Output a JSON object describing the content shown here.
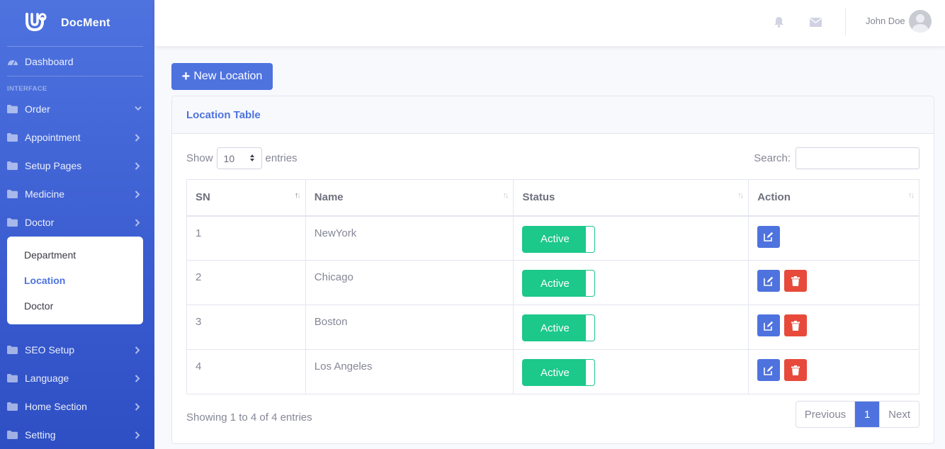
{
  "brand": {
    "name": "DocMent"
  },
  "sidebar": {
    "dashboard": "Dashboard",
    "heading": "INTERFACE",
    "items": [
      {
        "label": "Order",
        "icon": "folder-icon",
        "chevron": "down"
      },
      {
        "label": "Appointment",
        "icon": "folder-icon",
        "chevron": "right"
      },
      {
        "label": "Setup Pages",
        "icon": "folder-icon",
        "chevron": "right"
      },
      {
        "label": "Medicine",
        "icon": "folder-icon",
        "chevron": "right"
      },
      {
        "label": "Doctor",
        "icon": "folder-icon",
        "chevron": "right"
      }
    ],
    "submenu": [
      "Department",
      "Location",
      "Doctor"
    ],
    "submenu_active": "Location",
    "items_after": [
      {
        "label": "SEO Setup",
        "icon": "folder-icon"
      },
      {
        "label": "Language",
        "icon": "folder-icon"
      },
      {
        "label": "Home Section",
        "icon": "folder-icon"
      },
      {
        "label": "Setting",
        "icon": "folder-icon"
      }
    ]
  },
  "topbar": {
    "user_name": "John Doe"
  },
  "toolbar": {
    "new_button": "New Location"
  },
  "card": {
    "title": "Location Table",
    "show_label": "Show",
    "entries_label": "entries",
    "page_size": "10",
    "search_label": "Search:",
    "search_value": ""
  },
  "table": {
    "columns": [
      "SN",
      "Name",
      "Status",
      "Action"
    ],
    "rows": [
      {
        "sn": "1",
        "name": "NewYork",
        "status": "Active",
        "deletable": false
      },
      {
        "sn": "2",
        "name": "Chicago",
        "status": "Active",
        "deletable": true
      },
      {
        "sn": "3",
        "name": "Boston",
        "status": "Active",
        "deletable": true
      },
      {
        "sn": "4",
        "name": "Los Angeles",
        "status": "Active",
        "deletable": true
      }
    ]
  },
  "footer": {
    "info": "Showing 1 to 4 of 4 entries",
    "prev": "Previous",
    "page": "1",
    "next": "Next"
  },
  "colors": {
    "primary": "#4e73df",
    "success": "#1cc88a",
    "danger": "#e74a3b"
  }
}
